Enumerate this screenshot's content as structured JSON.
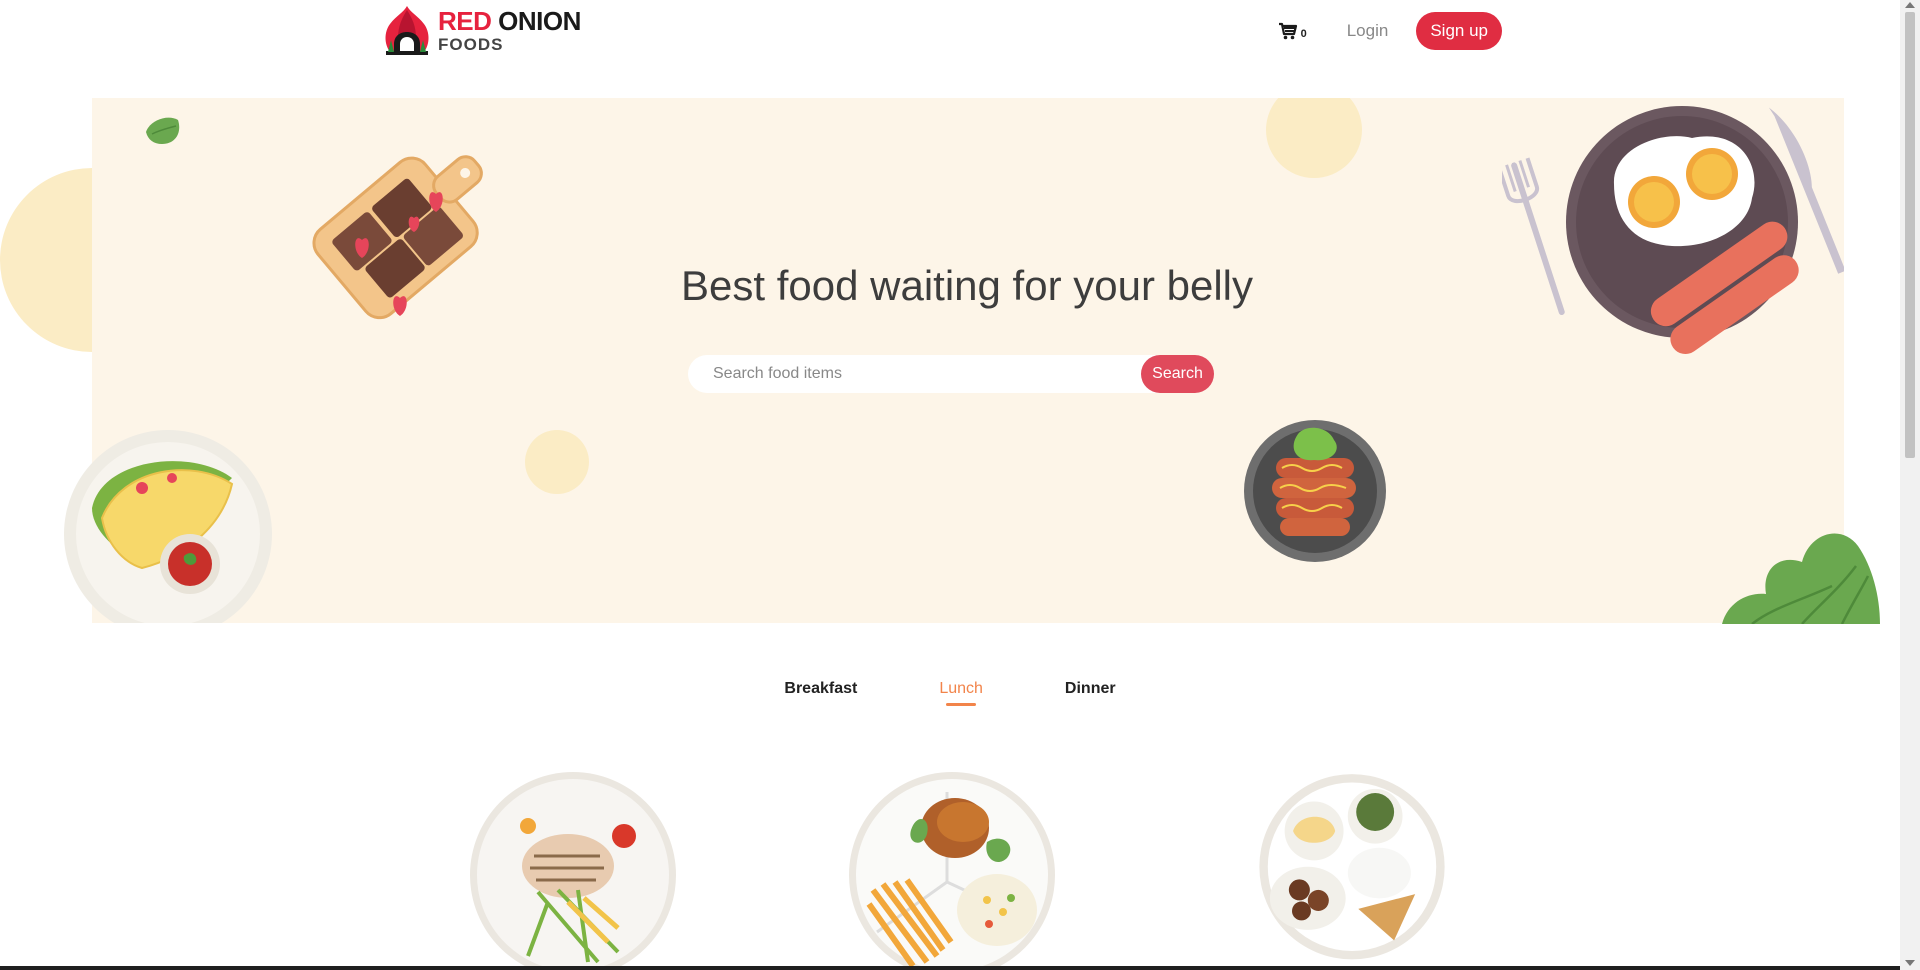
{
  "brand": {
    "line1_red": "RED",
    "line1_black": "ONION",
    "line2": "FOODS",
    "icon": "onion-logo-icon",
    "accent": "#e6223e"
  },
  "nav": {
    "cart_icon": "cart-icon",
    "cart_count": "0",
    "login_label": "Login",
    "signup_label": "Sign up",
    "signup_color": "#e02d42"
  },
  "hero": {
    "title": "Best food waiting for your belly",
    "search_placeholder": "Search food items",
    "search_value": "",
    "search_button": "Search",
    "background": "#fdf5e8"
  },
  "tabs": [
    {
      "label": "Breakfast",
      "active": false
    },
    {
      "label": "Lunch",
      "active": true
    },
    {
      "label": "Dinner",
      "active": false
    }
  ],
  "tab_accent": "#f2844a",
  "foods": [
    {
      "icon": "grilled-chicken-salad-plate-icon"
    },
    {
      "icon": "chicken-fries-rice-plate-icon"
    },
    {
      "icon": "mixed-platter-plate-icon"
    }
  ]
}
